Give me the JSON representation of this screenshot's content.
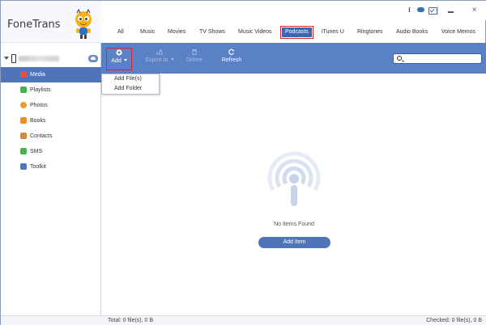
{
  "app": {
    "name": "FoneTrans"
  },
  "titlebar": {
    "facebook_glyph": "f",
    "close_glyph": "×",
    "icons": [
      "facebook-icon",
      "chat-icon",
      "feedback-icon",
      "minimize-icon",
      "close-icon"
    ]
  },
  "sidebar": {
    "items": [
      {
        "label": "Media",
        "icon": "music-note-icon",
        "color": "#e0524a",
        "active": true
      },
      {
        "label": "Playlists",
        "icon": "playlist-icon",
        "color": "#47b04f",
        "active": false
      },
      {
        "label": "Photos",
        "icon": "photos-icon",
        "color": "#e99a2e",
        "active": false
      },
      {
        "label": "Books",
        "icon": "books-icon",
        "color": "#f08a24",
        "active": false
      },
      {
        "label": "Contacts",
        "icon": "contacts-icon",
        "color": "#d48a3b",
        "active": false
      },
      {
        "label": "SMS",
        "icon": "sms-icon",
        "color": "#3fb54a",
        "active": false
      },
      {
        "label": "Toolkit",
        "icon": "toolkit-icon",
        "color": "#4a79c2",
        "active": false
      }
    ]
  },
  "tabs": [
    {
      "label": "All",
      "active": false
    },
    {
      "label": "Music",
      "active": false
    },
    {
      "label": "Movies",
      "active": false
    },
    {
      "label": "TV Shows",
      "active": false
    },
    {
      "label": "Music Videos",
      "active": false
    },
    {
      "label": "Podcasts",
      "active": true
    },
    {
      "label": "iTunes U",
      "active": false
    },
    {
      "label": "Ringtones",
      "active": false
    },
    {
      "label": "Audio Books",
      "active": false
    },
    {
      "label": "Voice Memos",
      "active": false
    }
  ],
  "toolbar": {
    "add_label": "Add",
    "export_label": "Export to",
    "delete_label": "Delete",
    "refresh_label": "Refresh"
  },
  "search": {
    "value": "",
    "placeholder": ""
  },
  "dropdown": {
    "items": [
      "Add File(s)",
      "Add Folder"
    ]
  },
  "main": {
    "empty_text": "No Items Found",
    "add_item_label": "Add Item",
    "empty_icon": "podcast-icon"
  },
  "status": {
    "total": "Total: 0 file(s), 0 B",
    "checked": "Checked: 0 file(s), 0 B"
  },
  "colors": {
    "toolbar": "#5a80c6",
    "accent": "#4f74b8",
    "highlight_box": "#d9262a",
    "facebook": "#3b5998"
  }
}
